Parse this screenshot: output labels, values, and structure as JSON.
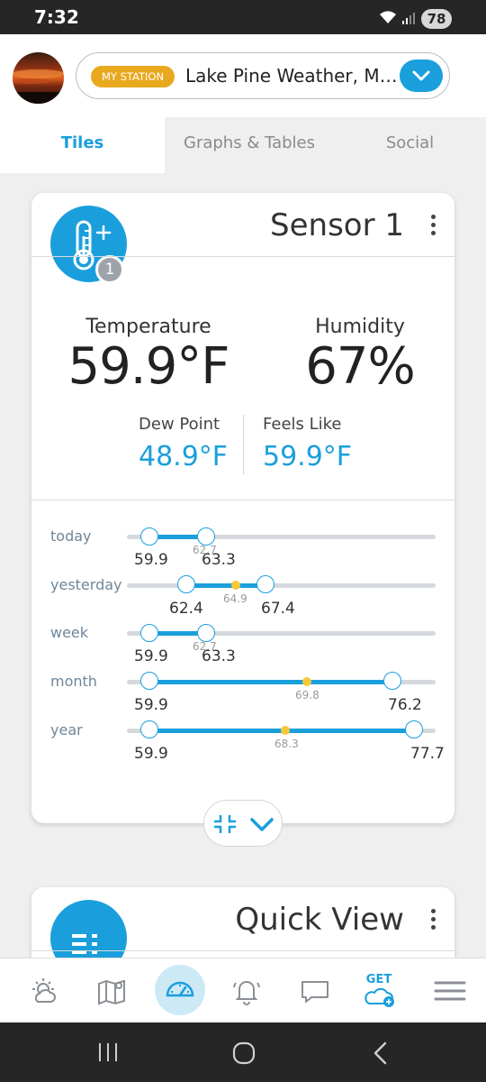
{
  "status_bar": {
    "time": "7:32",
    "battery": "78"
  },
  "header": {
    "station_badge": "MY STATION",
    "station_name": "Lake Pine Weather, Me..."
  },
  "tabs": [
    {
      "label": "Tiles",
      "active": true
    },
    {
      "label": "Graphs & Tables",
      "active": false
    },
    {
      "label": "Social",
      "active": false
    }
  ],
  "sensor_card": {
    "title": "Sensor 1",
    "badge": "1",
    "temperature_label": "Temperature",
    "temperature_value": "59.9°F",
    "humidity_label": "Humidity",
    "humidity_value": "67%",
    "dew_point_label": "Dew Point",
    "dew_point_value": "48.9°F",
    "feels_like_label": "Feels Like",
    "feels_like_value": "59.9°F",
    "ranges": [
      {
        "label": "today",
        "min": "59.9",
        "avg": "62.7",
        "max": "63.3"
      },
      {
        "label": "yesterday",
        "min": "62.4",
        "avg": "64.9",
        "max": "67.4"
      },
      {
        "label": "week",
        "min": "59.9",
        "avg": "62.7",
        "max": "63.3"
      },
      {
        "label": "month",
        "min": "59.9",
        "avg": "69.8",
        "max": "76.2"
      },
      {
        "label": "year",
        "min": "59.9",
        "avg": "68.3",
        "max": "77.7"
      }
    ]
  },
  "quick_view_card": {
    "title": "Quick View"
  },
  "bottom_nav": {
    "items": [
      "weather-icon",
      "map-icon",
      "dashboard-icon",
      "alerts-icon",
      "chat-icon",
      "get-cloud-icon",
      "menu-icon"
    ],
    "get_label": "GET"
  },
  "colors": {
    "accent": "#1a9fdc",
    "badge": "#e9a91f",
    "average": "#f4ca3a"
  }
}
